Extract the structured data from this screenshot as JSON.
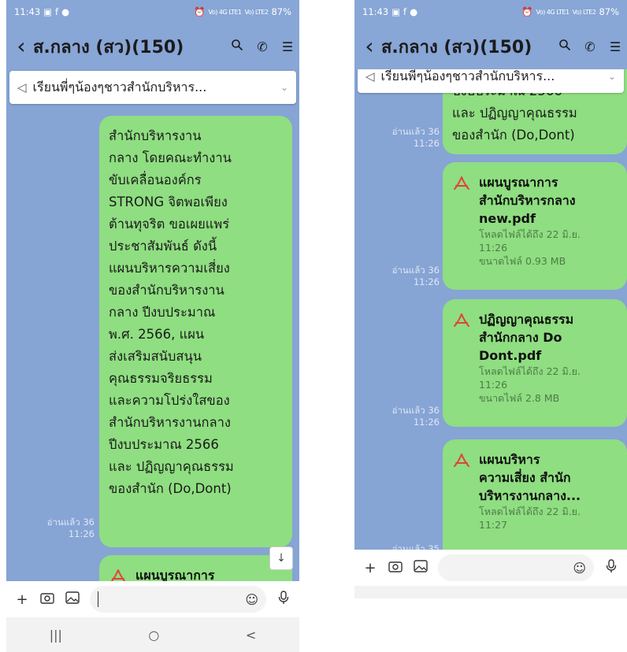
{
  "status": {
    "time": "11:43",
    "signal1": "Vo) 4G\nLTE1",
    "signal2": "Vo) LTE2",
    "battery": "87%"
  },
  "header": {
    "back_icon": "back-chevron",
    "title": "ส.กลาง (สว)(150)",
    "icons": [
      "search-icon",
      "phone-icon",
      "menu-icon"
    ]
  },
  "announcement": {
    "text": "เรียนพี่ๆน้องๆชาวสำนักบริหาร..."
  },
  "left": {
    "message_text": "สำนักบริหารงาน\nกลาง โดยคณะทำงาน\nขับเคลื่อนองค์กร\nSTRONG จิตพอเพียง\nต้านทุจริต ขอเผยแพร่\nประชาสัมพันธ์ ดังนี้\nแผนบริหารความเสี่ยง\nของสำนักบริหารงาน\nกลาง ปีงบประมาณ\nพ.ศ. 2566, แผน\nส่งเสริมสนับสนุน\nคุณธรรมจริยธรรม\nและความโปร่งใสของ\nสำนักบริหารงานกลาง\nปีงบประมาณ 2566\nและ ปฏิญญาคุณธรรม\nของสำนัก (Do,Dont)",
    "read_info": "อ่านแล้ว 36\n11:26",
    "next_file_name": "แผนบูรณาการ"
  },
  "right": {
    "partial_text": "ปีงบประมาณ 2566\nและ ปฏิญญาคุณธรรม\nของสำนัก (Do,Dont)",
    "messages": [
      {
        "file_name": "แผนบูรณาการ\nสำนักบริหารกลาง\nnew.pdf",
        "expiry": "โหลดไฟล์ได้ถึง 22 มิ.ย.\n11:26",
        "size": "ขนาดไฟล์ 0.93 MB",
        "read_info": "อ่านแล้ว 36\n11:26"
      },
      {
        "file_name": "ปฏิญญาคุณธรรม\nสำนักกลาง Do\nDont.pdf",
        "expiry": "โหลดไฟล์ได้ถึง 22 มิ.ย.\n11:26",
        "size": "ขนาดไฟล์ 2.8 MB",
        "read_info": "อ่านแล้ว 36\n11:26"
      },
      {
        "file_name": "แผนบริหาร\nความเสี่ยง สำนัก\nบริหารงานกลาง...",
        "expiry": "โหลดไฟล์ได้ถึง 22 มิ.ย.\n11:27",
        "read_info": "อ่านแล้ว 35"
      }
    ]
  },
  "input": {
    "plus_icon": "plus-icon",
    "camera_icon": "camera-icon",
    "image_icon": "image-icon",
    "emoji_icon": "emoji-icon",
    "mic_icon": "mic-icon"
  },
  "navbar": {
    "recent": "|||",
    "home": "○",
    "back": "<"
  },
  "colors": {
    "header_bg": "#88a6d6",
    "chat_bg": "#86a4d4",
    "bubble": "#8fde81",
    "pdf_red": "#e0443a"
  }
}
